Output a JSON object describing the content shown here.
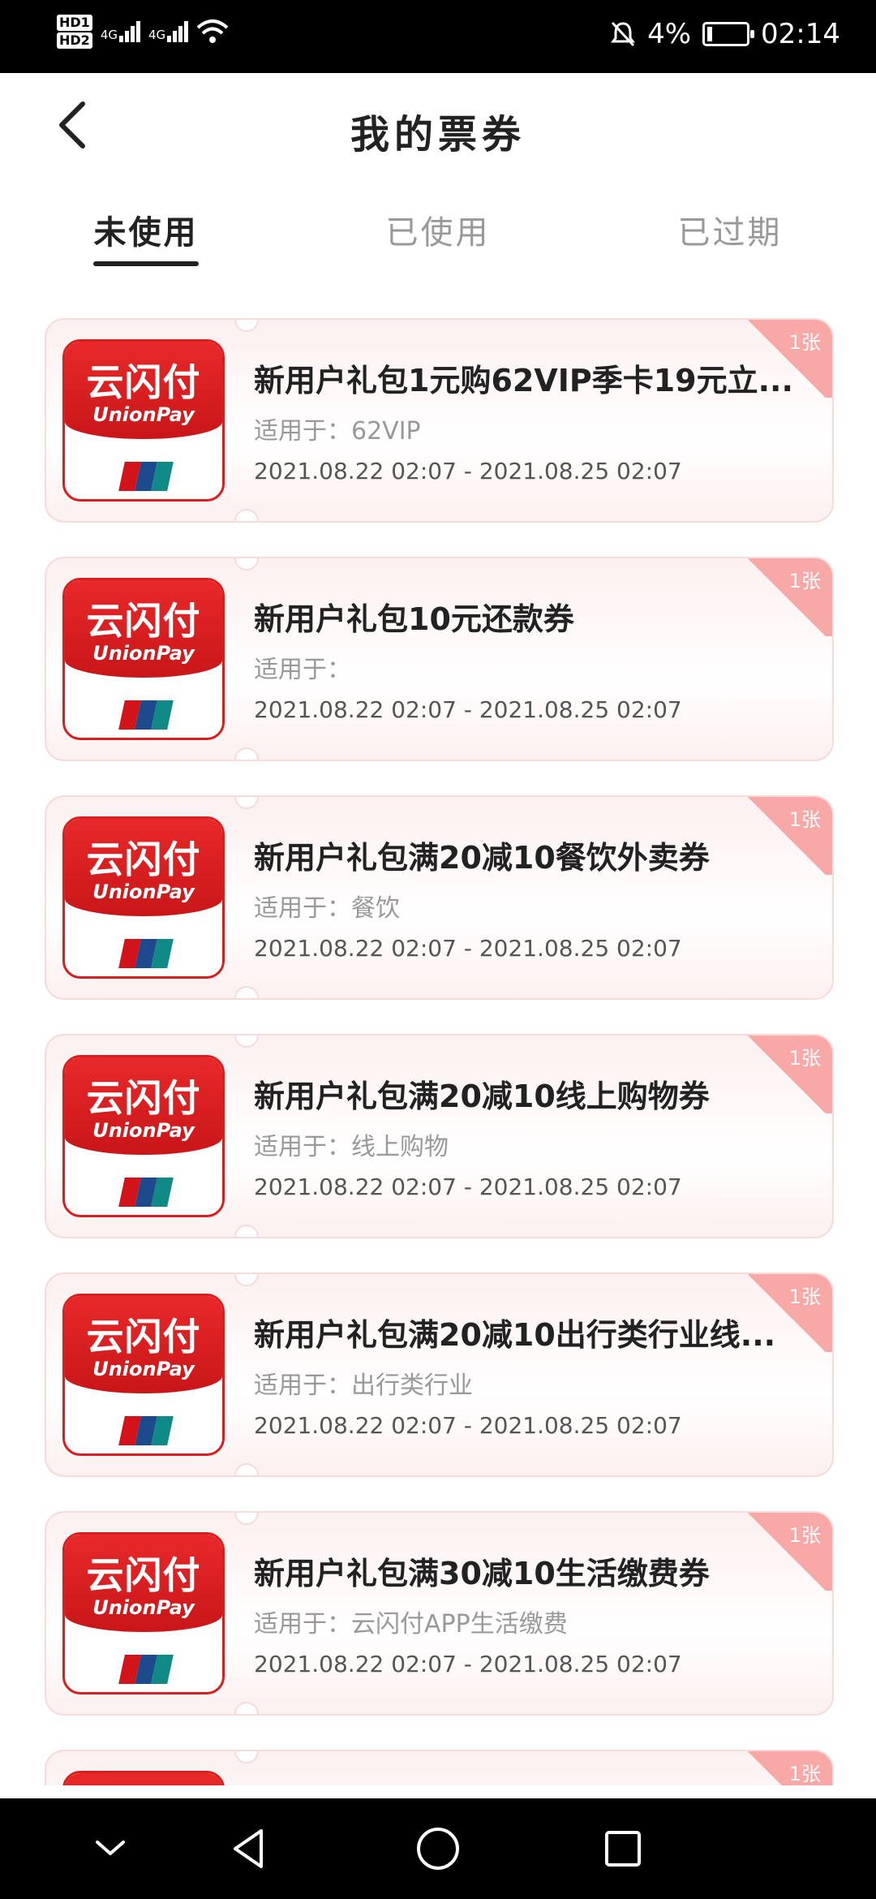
{
  "status_bar": {
    "hd1": "HD1",
    "hd2": "HD2",
    "net1": "4G",
    "net2": "4G",
    "battery": "4%",
    "time": "02:14"
  },
  "header": {
    "title": "我的票券",
    "back_icon": "chevron-left-icon"
  },
  "tabs": [
    {
      "label": "未使用",
      "active": true
    },
    {
      "label": "已使用",
      "active": false
    },
    {
      "label": "已过期",
      "active": false
    }
  ],
  "logo": {
    "cn": "云闪付",
    "en": "UnionPay"
  },
  "coupons": [
    {
      "title": "新用户礼包1元购62VIP季卡19元立...",
      "scope": "适用于：62VIP",
      "date": "2021.08.22 02:07 - 2021.08.25 02:07",
      "count": "1张"
    },
    {
      "title": "新用户礼包10元还款券",
      "scope": "适用于：",
      "date": "2021.08.22 02:07 - 2021.08.25 02:07",
      "count": "1张"
    },
    {
      "title": "新用户礼包满20减10餐饮外卖券",
      "scope": "适用于：餐饮",
      "date": "2021.08.22 02:07 - 2021.08.25 02:07",
      "count": "1张"
    },
    {
      "title": "新用户礼包满20减10线上购物券",
      "scope": "适用于：线上购物",
      "date": "2021.08.22 02:07 - 2021.08.25 02:07",
      "count": "1张"
    },
    {
      "title": "新用户礼包满20减10出行类行业线...",
      "scope": "适用于：出行类行业",
      "date": "2021.08.22 02:07 - 2021.08.25 02:07",
      "count": "1张"
    },
    {
      "title": "新用户礼包满30减10生活缴费券",
      "scope": "适用于：云闪付APP生活缴费",
      "date": "2021.08.22 02:07 - 2021.08.25 02:07",
      "count": "1张"
    },
    {
      "title": "",
      "scope": "",
      "date": "",
      "count": "1张"
    }
  ],
  "nav": [
    "chevron-down-icon",
    "back-triangle-icon",
    "home-circle-icon",
    "recents-square-icon"
  ]
}
